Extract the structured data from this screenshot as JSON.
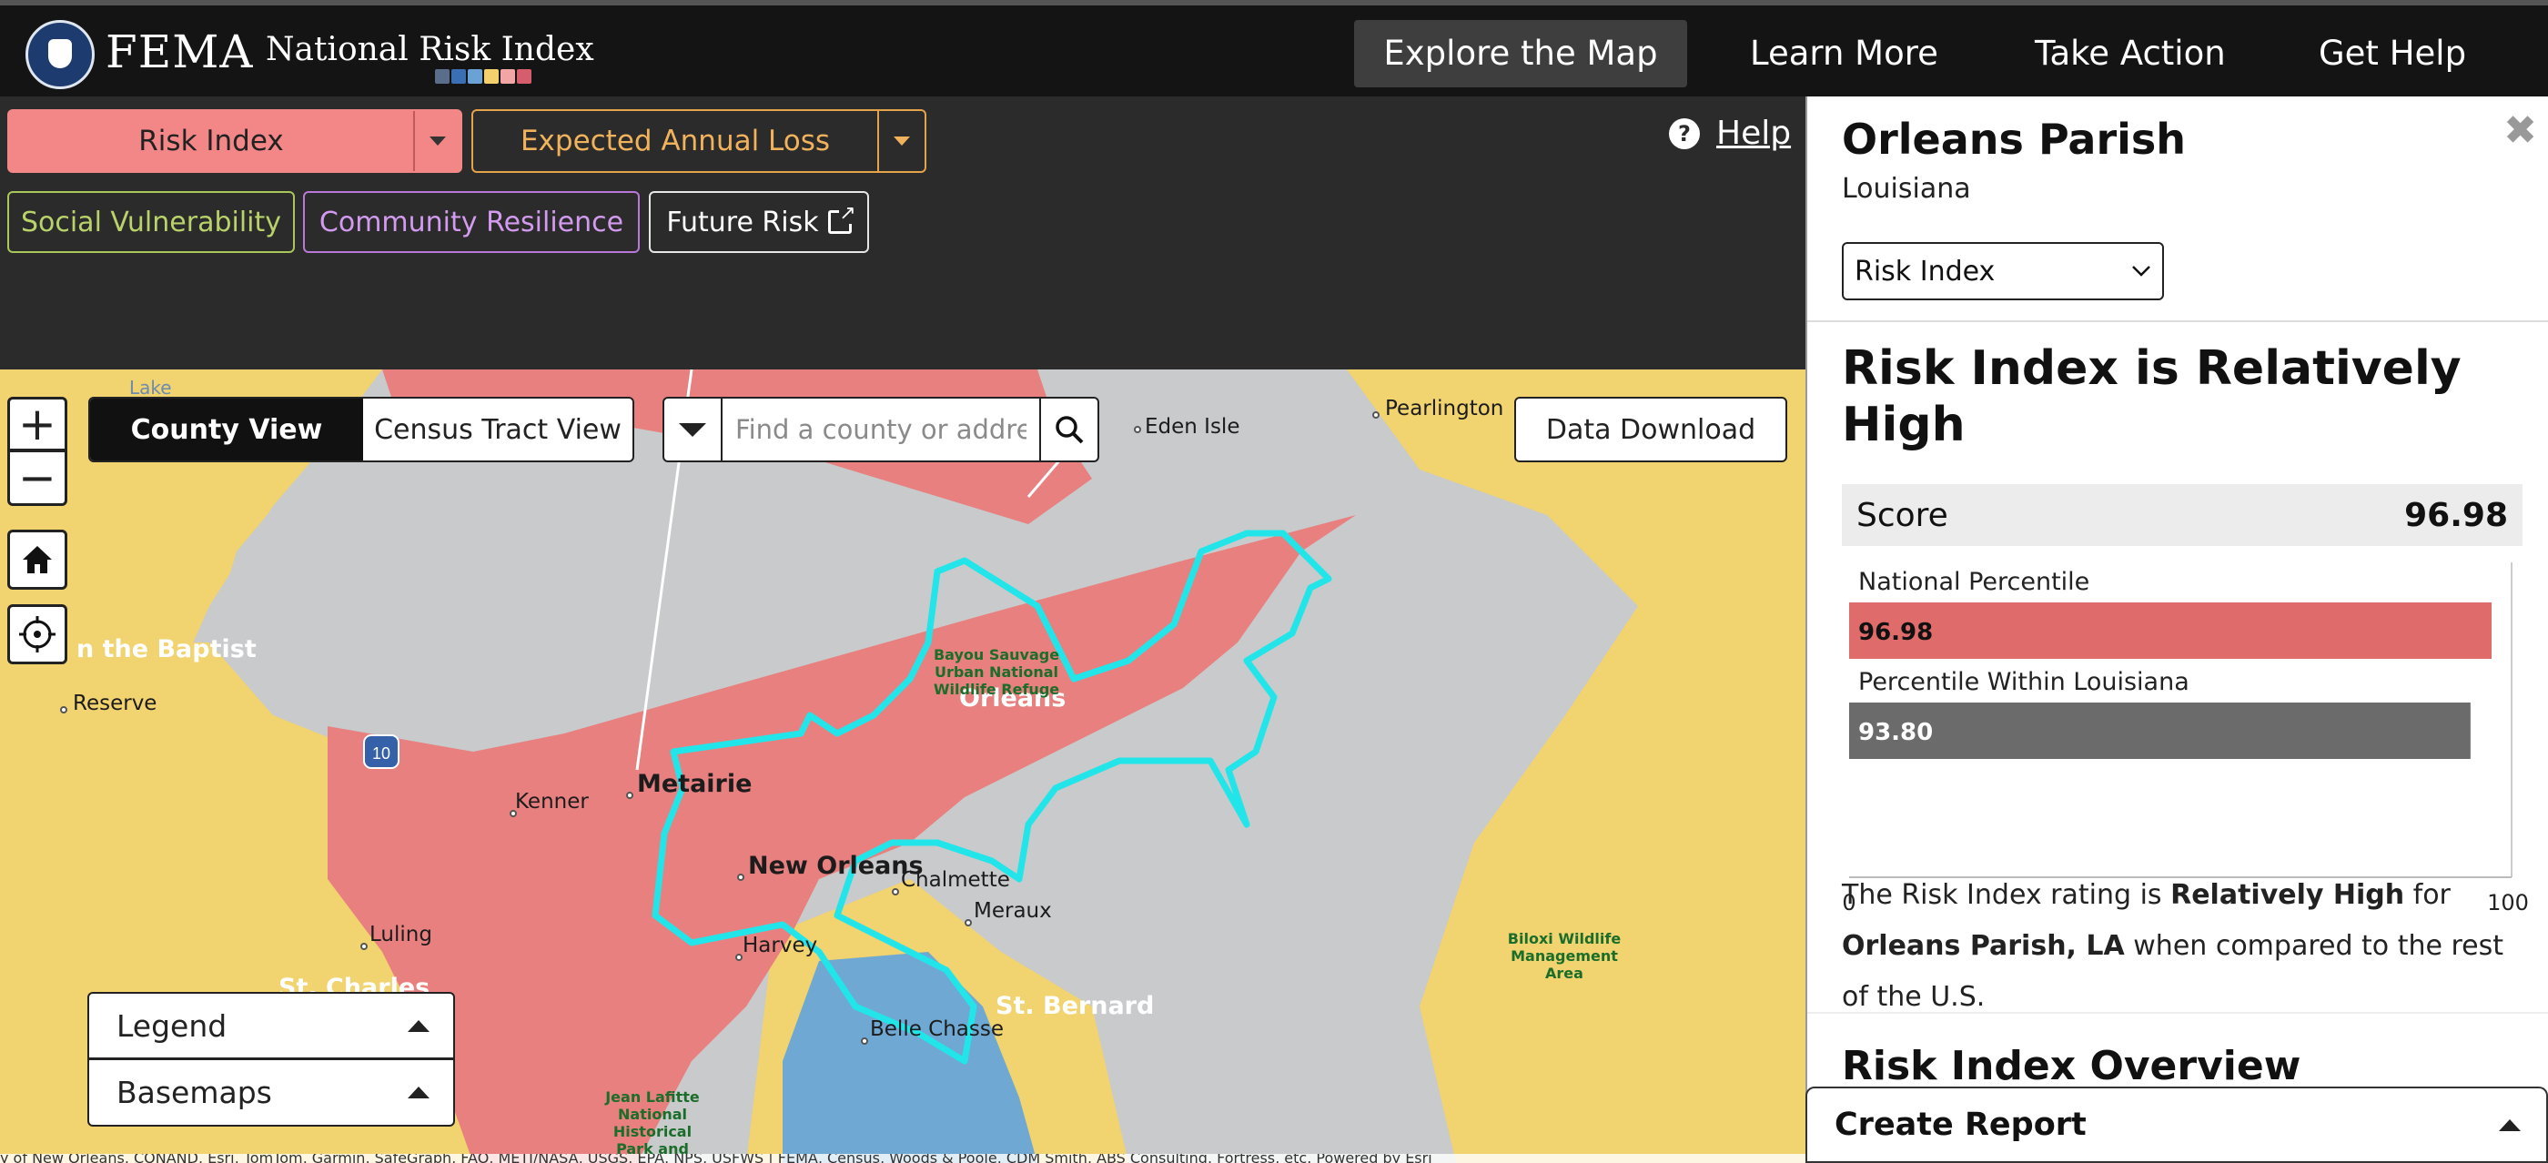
{
  "header": {
    "agency": "FEMA",
    "app_title": "National Risk Index",
    "swatch_colors": [
      "#5a6e8c",
      "#3b6fb4",
      "#6aa2d6",
      "#f2d06b",
      "#f2a5a5",
      "#d65d6b"
    ],
    "nav": [
      {
        "label": "Explore the Map"
      },
      {
        "label": "Learn More"
      },
      {
        "label": "Take Action"
      },
      {
        "label": "Get Help"
      }
    ]
  },
  "controls": {
    "risk_index": "Risk Index",
    "expected_annual_loss": "Expected Annual Loss",
    "social_vulnerability": "Social Vulnerability",
    "community_resilience": "Community Resilience",
    "future_risk": "Future Risk",
    "help": "Help"
  },
  "map": {
    "views": {
      "county": "County View",
      "tract": "Census Tract View"
    },
    "search_placeholder": "Find a county or address",
    "data_download": "Data Download",
    "legend": "Legend",
    "basemaps": "Basemaps",
    "highway_shield": "10",
    "attribution": "y of New Orleans, CONAND, Esri, TomTom, Garmin, SafeGraph, FAO, METI/NASA, USGS, EPA, NPS, USFWS | FEMA, Census, Woods & Poole, CDM Smith, ABS Consulting, Fortress, etc. Powered by Esri",
    "colors": {
      "high": "#e88080",
      "moderate": "#f1d36f",
      "low": "#6fa8d2",
      "water": "#c9cacb",
      "selected": "#22e5ea"
    },
    "labels": {
      "lake": "Lake",
      "eden_isle": "Eden Isle",
      "pearlington": "Pearlington",
      "baptist": "n the Baptist",
      "reserve": "Reserve",
      "kenner": "Kenner",
      "metairie": "Metairie",
      "new_orleans": "New Orleans",
      "chalmette": "Chalmette",
      "meraux": "Meraux",
      "harvey": "Harvey",
      "luling": "Luling",
      "st_charles": "St. Charles",
      "st_bernard": "St. Bernard",
      "belle_chasse": "Belle Chasse",
      "orleans": "Orleans",
      "bayou_sauvage": "Bayou Sauvage Urban National Wildlife Refuge",
      "biloxi": "Biloxi Wildlife Management Area",
      "jean_lafitte": "Jean Lafitte National Historical Park and Preserve"
    }
  },
  "panel": {
    "county": "Orleans Parish",
    "state": "Louisiana",
    "selector": "Risk Index",
    "headline": "Risk Index is Relatively High",
    "score_label": "Score",
    "score_value": "96.98",
    "rating_sentence": {
      "pre": "The Risk Index rating is ",
      "rating": "Relatively High",
      "mid": " for ",
      "place": "Orleans Parish, LA",
      "post": " when compared to the rest of the U.S."
    },
    "overview_title": "Risk Index Overview",
    "create_report": "Create Report"
  },
  "chart_data": {
    "type": "bar",
    "orientation": "horizontal",
    "categories": [
      "National Percentile",
      "Percentile Within Louisiana"
    ],
    "values": [
      96.98,
      93.8
    ],
    "value_labels": [
      "96.98",
      "93.80"
    ],
    "colors": [
      "#e06b6b",
      "#6b6b6b"
    ],
    "xlim": [
      0,
      100
    ],
    "xticks": [
      "0",
      "100"
    ]
  }
}
